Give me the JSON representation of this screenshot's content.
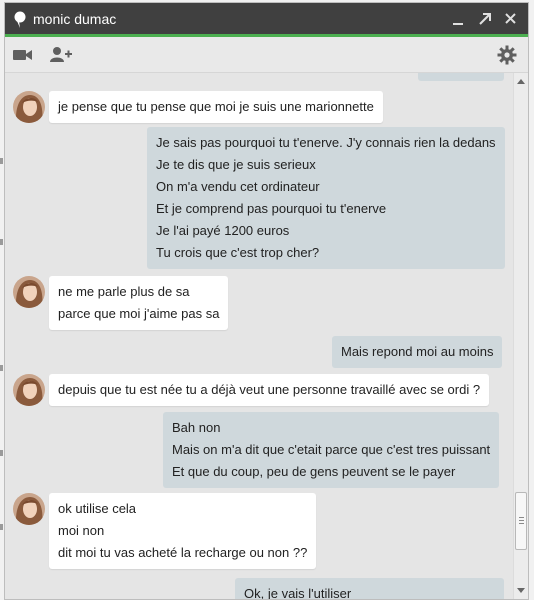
{
  "window": {
    "title": "monic dumac",
    "minimize_label": "minimize",
    "popout_label": "pop out",
    "close_label": "close"
  },
  "toolbar": {
    "icons": [
      "video-call-icon",
      "add-person-icon",
      "settings-gear-icon"
    ]
  },
  "messages": [
    {
      "from": "contact",
      "lines": [
        "je pense que tu pense  que moi je suis une marionnette"
      ]
    },
    {
      "from": "me",
      "lines": [
        "Je sais pas pourquoi tu t'enerve. J'y connais rien la dedans",
        "Je te dis que je suis serieux",
        "On m'a vendu cet ordinateur",
        "Et je comprend pas pourquoi tu t'enerve",
        "Je l'ai payé 1200 euros",
        "Tu crois que c'est trop cher?"
      ]
    },
    {
      "from": "contact",
      "lines": [
        "ne me parle plus de sa",
        "parce que moi j'aime pas sa"
      ]
    },
    {
      "from": "me",
      "lines": [
        "Mais repond moi au moins"
      ]
    },
    {
      "from": "contact",
      "lines": [
        "depuis que tu est née tu a déjà veut une personne travaillé avec se ordi ?"
      ]
    },
    {
      "from": "me",
      "lines": [
        "Bah non",
        "Mais on m'a dit que c'etait parce que c'est tres puissant",
        "Et que du coup, peu de gens peuvent se le payer"
      ]
    },
    {
      "from": "contact",
      "lines": [
        "ok utilise cela",
        "moi non",
        "dit moi tu vas acheté la recharge ou non ??"
      ]
    },
    {
      "from": "me",
      "lines": [
        "Ok, je vais l'utiliser"
      ]
    }
  ],
  "colors": {
    "titlebar": "#404040",
    "accent": "#4caf50",
    "incoming_bubble": "#ffffff",
    "outgoing_bubble": "#cfd8dc",
    "chat_background": "#e5e5e5"
  }
}
